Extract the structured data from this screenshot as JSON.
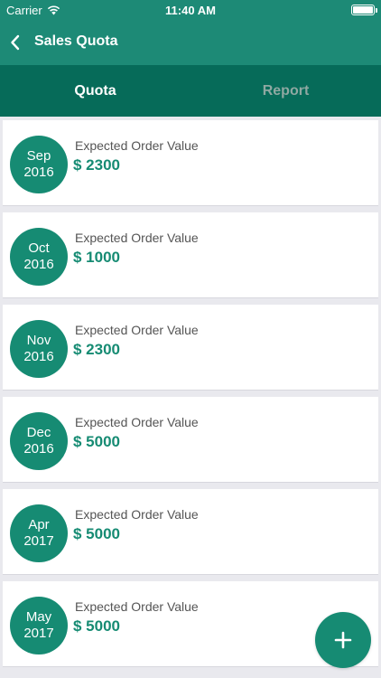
{
  "status_bar": {
    "carrier": "Carrier",
    "time": "11:40 AM"
  },
  "nav": {
    "title": "Sales Quota",
    "back_icon": "chevron-left-icon"
  },
  "tabs": [
    {
      "label": "Quota",
      "active": true
    },
    {
      "label": "Report",
      "active": false
    }
  ],
  "quotas": [
    {
      "month": "Sep",
      "year": "2016",
      "label": "Expected Order Value",
      "value": "$ 2300"
    },
    {
      "month": "Oct",
      "year": "2016",
      "label": "Expected Order Value",
      "value": "$ 1000"
    },
    {
      "month": "Nov",
      "year": "2016",
      "label": "Expected Order Value",
      "value": "$ 2300"
    },
    {
      "month": "Dec",
      "year": "2016",
      "label": "Expected Order Value",
      "value": "$ 5000"
    },
    {
      "month": "Apr",
      "year": "2017",
      "label": "Expected Order Value",
      "value": "$ 5000"
    },
    {
      "month": "May",
      "year": "2017",
      "label": "Expected Order Value",
      "value": "$ 5000"
    }
  ],
  "fab": {
    "icon": "plus-icon"
  },
  "colors": {
    "primary": "#1d8a76",
    "tab_bar": "#066b59",
    "accent": "#168b73",
    "background": "#e9e9ee"
  }
}
